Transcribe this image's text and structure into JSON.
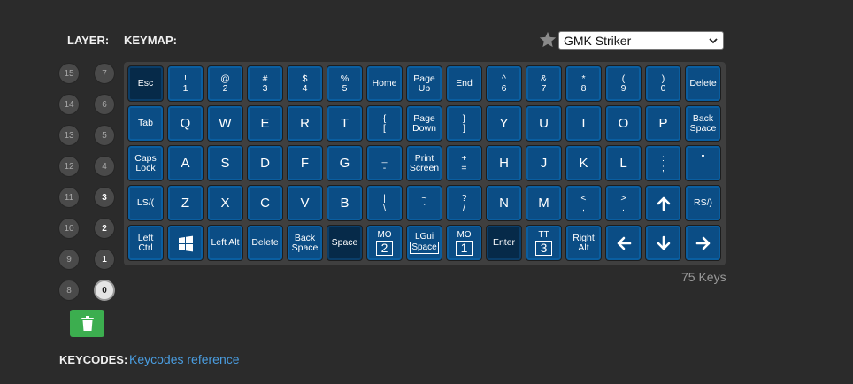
{
  "header": {
    "layer_label": "LAYER:",
    "keymap_label": "KEYMAP:",
    "favorite_icon": "star-icon",
    "keymap_select": {
      "selected": "GMK Striker"
    }
  },
  "layers": {
    "right_column": [
      "7",
      "6",
      "5",
      "4",
      "3",
      "2",
      "1",
      "0"
    ],
    "left_column": [
      "15",
      "14",
      "13",
      "12",
      "11",
      "10",
      "9",
      "8"
    ],
    "active": [
      "3",
      "2",
      "1",
      "0"
    ],
    "selected": "0"
  },
  "delete_layer_icon": "trash-icon",
  "keyboard": {
    "rows": [
      [
        {
          "t": "Esc",
          "d": true
        },
        {
          "t": "!",
          "b": "1"
        },
        {
          "t": "@",
          "b": "2"
        },
        {
          "t": "#",
          "b": "3"
        },
        {
          "t": "$",
          "b": "4"
        },
        {
          "t": "%",
          "b": "5"
        },
        {
          "t": "Home"
        },
        {
          "t": "Page",
          "b": "Up"
        },
        {
          "t": "End"
        },
        {
          "t": "^",
          "b": "6"
        },
        {
          "t": "&",
          "b": "7"
        },
        {
          "t": "*",
          "b": "8"
        },
        {
          "t": "(",
          "b": "9"
        },
        {
          "t": ")",
          "b": "0"
        },
        {
          "t": "Delete"
        }
      ],
      [
        {
          "t": "Tab"
        },
        {
          "t": "Q",
          "big": true
        },
        {
          "t": "W",
          "big": true
        },
        {
          "t": "E",
          "big": true
        },
        {
          "t": "R",
          "big": true
        },
        {
          "t": "T",
          "big": true
        },
        {
          "t": "{",
          "b": "["
        },
        {
          "t": "Page",
          "b": "Down"
        },
        {
          "t": "}",
          "b": "]"
        },
        {
          "t": "Y",
          "big": true
        },
        {
          "t": "U",
          "big": true
        },
        {
          "t": "I",
          "big": true
        },
        {
          "t": "O",
          "big": true
        },
        {
          "t": "P",
          "big": true
        },
        {
          "t": "Back",
          "b": "Space"
        }
      ],
      [
        {
          "t": "Caps",
          "b": "Lock"
        },
        {
          "t": "A",
          "big": true
        },
        {
          "t": "S",
          "big": true
        },
        {
          "t": "D",
          "big": true
        },
        {
          "t": "F",
          "big": true
        },
        {
          "t": "G",
          "big": true
        },
        {
          "t": "_",
          "b": "-"
        },
        {
          "t": "Print",
          "b": "Screen"
        },
        {
          "t": "+",
          "b": "="
        },
        {
          "t": "H",
          "big": true
        },
        {
          "t": "J",
          "big": true
        },
        {
          "t": "K",
          "big": true
        },
        {
          "t": "L",
          "big": true
        },
        {
          "t": ":",
          "b": ";"
        },
        {
          "t": "\"",
          "b": "'"
        }
      ],
      [
        {
          "t": "LS/("
        },
        {
          "t": "Z",
          "big": true
        },
        {
          "t": "X",
          "big": true
        },
        {
          "t": "C",
          "big": true
        },
        {
          "t": "V",
          "big": true
        },
        {
          "t": "B",
          "big": true
        },
        {
          "t": "|",
          "b": "\\"
        },
        {
          "t": "~",
          "b": "`"
        },
        {
          "t": "?",
          "b": "/"
        },
        {
          "t": "N",
          "big": true
        },
        {
          "t": "M",
          "big": true
        },
        {
          "t": "<",
          "b": ","
        },
        {
          "t": ">",
          "b": "."
        },
        {
          "icon": "arrow-up-icon"
        },
        {
          "t": "RS/)"
        }
      ],
      [
        {
          "t": "Left",
          "b": "Ctrl"
        },
        {
          "icon": "windows-icon"
        },
        {
          "t": "Left Alt"
        },
        {
          "t": "Delete"
        },
        {
          "t": "Back",
          "b": "Space"
        },
        {
          "t": "Space",
          "d": true
        },
        {
          "t": "MO",
          "layer": "2"
        },
        {
          "t": "LGui",
          "boxed": "Space"
        },
        {
          "t": "MO",
          "layer": "1"
        },
        {
          "t": "Enter",
          "d": true
        },
        {
          "t": "TT",
          "layer": "3"
        },
        {
          "t": "Right",
          "b": "Alt"
        },
        {
          "icon": "arrow-left-icon"
        },
        {
          "icon": "arrow-down-icon"
        },
        {
          "icon": "arrow-right-icon"
        }
      ]
    ]
  },
  "key_count": "75 Keys",
  "footer": {
    "keycodes_label": "KEYCODES:",
    "keycodes_link": "Keycodes reference"
  }
}
